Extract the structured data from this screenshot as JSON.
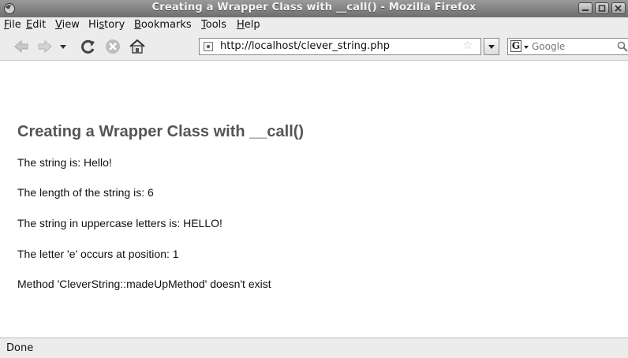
{
  "window": {
    "title": "Creating a Wrapper Class with __call() - Mozilla Firefox"
  },
  "menu": [
    {
      "pre": "",
      "key": "F",
      "post": "ile"
    },
    {
      "pre": "",
      "key": "E",
      "post": "dit"
    },
    {
      "pre": "",
      "key": "V",
      "post": "iew"
    },
    {
      "pre": "Hi",
      "key": "s",
      "post": "tory"
    },
    {
      "pre": "",
      "key": "B",
      "post": "ookmarks"
    },
    {
      "pre": "",
      "key": "T",
      "post": "ools"
    },
    {
      "pre": "",
      "key": "H",
      "post": "elp"
    }
  ],
  "toolbar": {
    "url": "http://localhost/clever_string.php",
    "search_engine": "G",
    "search_placeholder": "Google"
  },
  "page": {
    "heading": "Creating a Wrapper Class with __call()",
    "lines": [
      "The string is: Hello!",
      "The length of the string is: 6",
      "The string in uppercase letters is: HELLO!",
      "The letter 'e' occurs at position: 1",
      "Method 'CleverString::madeUpMethod' doesn't exist"
    ]
  },
  "status": {
    "text": "Done"
  },
  "icons": {
    "app": "firefox-icon",
    "back": "back-arrow-icon",
    "forward": "forward-arrow-icon",
    "history_dropdown": "chevron-down-icon",
    "reload": "reload-icon",
    "stop": "stop-icon",
    "home": "home-icon",
    "bookmark_star": "star-icon",
    "search": "magnifier-icon"
  }
}
